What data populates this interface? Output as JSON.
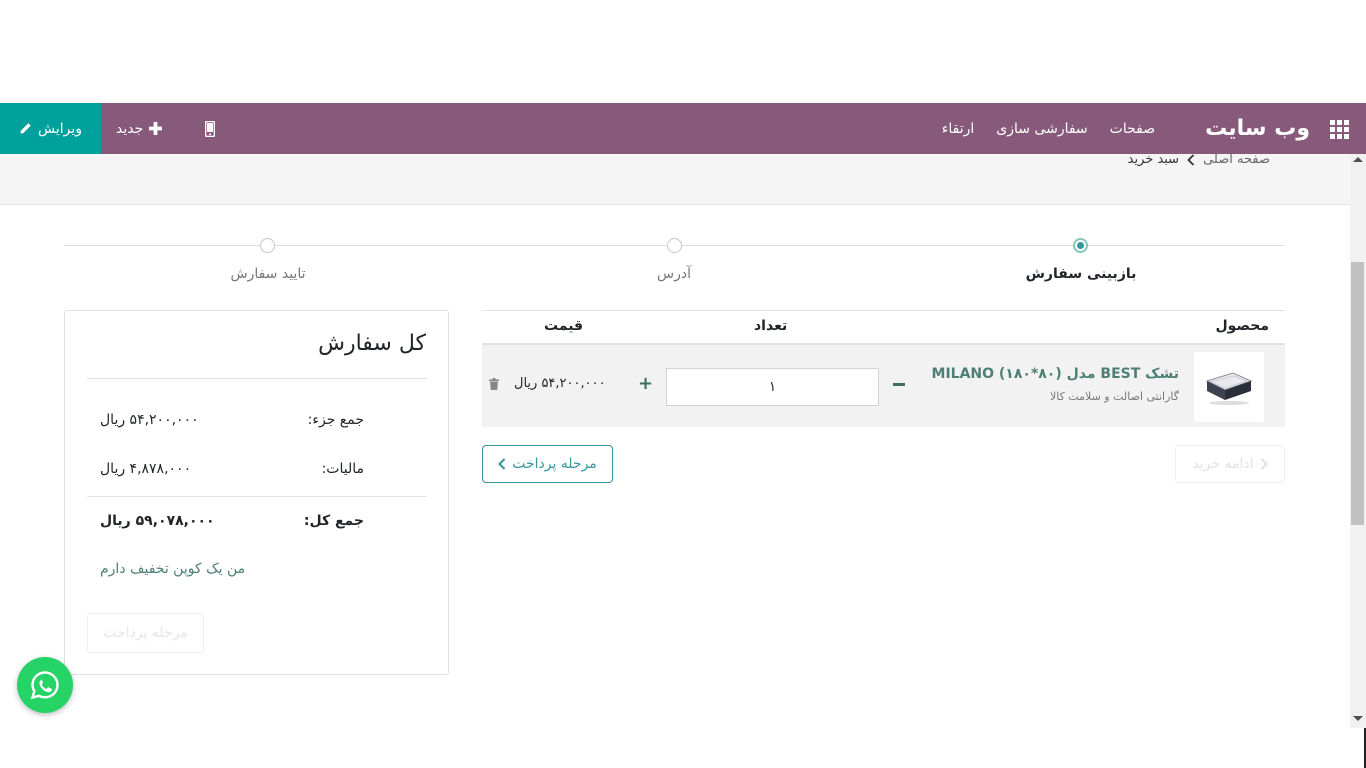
{
  "topbar": {
    "edit_label": "ویرایش",
    "new_label": "جدید",
    "site_title": "وب سایت",
    "menu": [
      "صفحات",
      "سفارشی سازی",
      "ارتقاء"
    ]
  },
  "breadcrumb": {
    "home": "صفحه اصلی",
    "current": "سبد خرید"
  },
  "wizard": {
    "steps": [
      "بازبینی سفارش",
      "آدرس",
      "تایید سفارش"
    ],
    "active_step": 0
  },
  "cart": {
    "headers": {
      "product": "محصول",
      "quantity": "تعداد",
      "price": "قیمت"
    },
    "items": [
      {
        "name": "تشک BEST مدل MILANO (۱۸۰*۸۰)",
        "subtitle": "گارانتی اصالت و سلامت کالا",
        "quantity": "۱",
        "price": "۵۴,۲۰۰,۰۰۰ ریال"
      }
    ],
    "pay_button": "مرحله پرداخت",
    "continue_button": "ادامه خرید"
  },
  "summary": {
    "title": "کل سفارش",
    "subtotal_label": "جمع جزء:",
    "subtotal_value": "۵۴,۲۰۰,۰۰۰ ریال",
    "tax_label": "مالیات:",
    "tax_value": "۴,۸۷۸,۰۰۰ ریال",
    "total_label": "جمع کل:",
    "total_value": "۵۹,۰۷۸,۰۰۰ ریال",
    "coupon_link": "من یک کوپن تخفیف دارم",
    "pay_button": "مرحله پرداخت"
  },
  "colors": {
    "topbar": "#875A7B",
    "edit_button": "#00A09D",
    "accent": "#35979c",
    "whatsapp": "#25d366"
  },
  "icons": {
    "edit": "pencil-icon",
    "new": "plus-icon",
    "mobile": "mobile-icon",
    "apps": "apps-grid-icon",
    "whatsapp": "whatsapp-icon",
    "remove": "trash-icon"
  }
}
